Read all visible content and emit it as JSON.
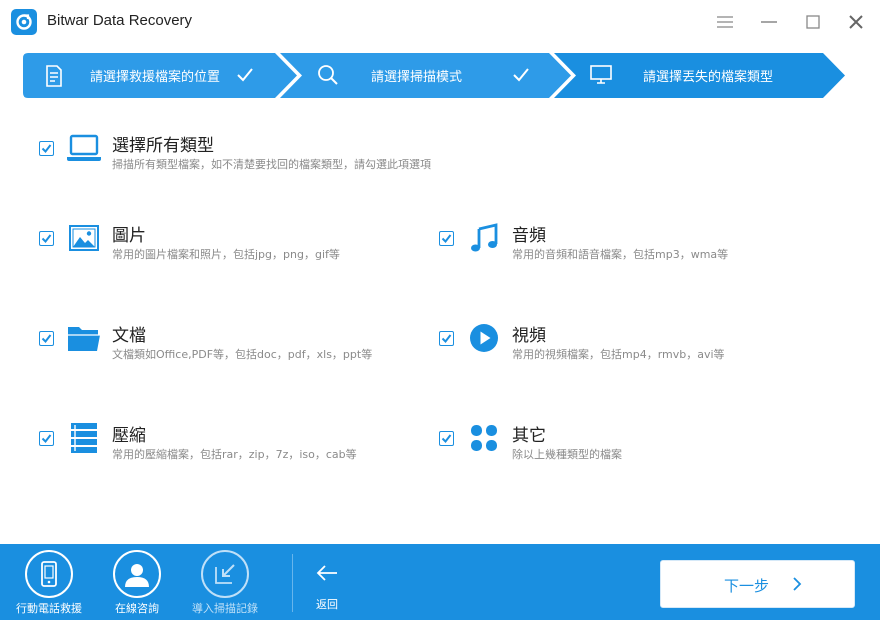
{
  "window": {
    "title": "Bitwar Data Recovery",
    "controls": [
      "menu-icon",
      "minimize-icon",
      "maximize-icon",
      "close-icon"
    ]
  },
  "steps": [
    {
      "label": "請選擇救援檔案的位置",
      "icon": "document-icon",
      "done": true
    },
    {
      "label": "請選擇掃描模式",
      "icon": "search-icon",
      "done": true
    },
    {
      "label": "請選擇丟失的檔案類型",
      "icon": "monitor-icon",
      "done": false
    }
  ],
  "options": {
    "all": {
      "title": "選擇所有類型",
      "desc": "掃描所有類型檔案，如不清楚要找回的檔案類型，請勾選此項選項",
      "icon": "laptop-icon",
      "checked": true
    },
    "pictures": {
      "title": "圖片",
      "desc": "常用的圖片檔案和照片，包括jpg，png，gif等",
      "icon": "picture-icon",
      "checked": true
    },
    "audio": {
      "title": "音頻",
      "desc": "常用的音頻和語音檔案，包括mp3，wma等",
      "icon": "music-note-icon",
      "checked": true
    },
    "documents": {
      "title": "文檔",
      "desc": "文檔類如Office,PDF等，包括doc，pdf，xls，ppt等",
      "icon": "folder-icon",
      "checked": true
    },
    "video": {
      "title": "視頻",
      "desc": "常用的視頻檔案，包括mp4，rmvb，avi等",
      "icon": "play-icon",
      "checked": true
    },
    "archive": {
      "title": "壓縮",
      "desc": "常用的壓縮檔案，包括rar，zip，7z，iso，cab等",
      "icon": "archive-icon",
      "checked": true
    },
    "other": {
      "title": "其它",
      "desc": "除以上幾種類型的檔案",
      "icon": "grid-dots-icon",
      "checked": true
    }
  },
  "bottom": {
    "tools": [
      {
        "label": "行動電話救援",
        "icon": "phone-icon",
        "enabled": true
      },
      {
        "label": "在線咨詢",
        "icon": "user-icon",
        "enabled": true
      },
      {
        "label": "導入掃描記錄",
        "icon": "import-icon",
        "enabled": false
      }
    ],
    "back_label": "返回",
    "next_label": "下一步"
  },
  "colors": {
    "accent": "#1a8fe0",
    "step_done": "#2e9be8",
    "step_current": "#1a8fe0",
    "text": "#222222",
    "desc": "#8a8a8a"
  }
}
